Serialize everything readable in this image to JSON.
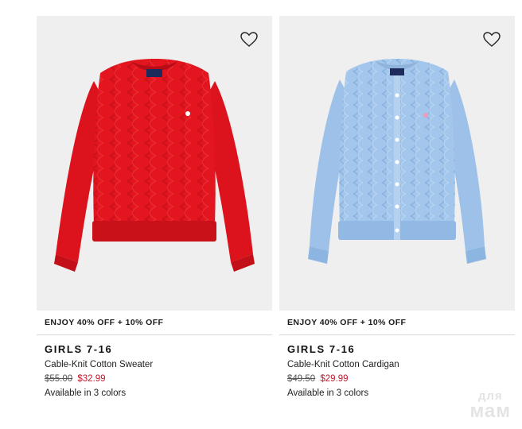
{
  "products": [
    {
      "promo": "ENJOY 40% OFF + 10% OFF",
      "category": "GIRLS 7-16",
      "name": "Cable-Knit Cotton Sweater",
      "original_price": "$55.00",
      "sale_price": "$32.99",
      "availability": "Available in 3 colors",
      "color": "#e3151f",
      "favorite_icon": "heart-outline-icon"
    },
    {
      "promo": "ENJOY 40% OFF + 10% OFF",
      "category": "GIRLS 7-16",
      "name": "Cable-Knit Cotton Cardigan",
      "original_price": "$49.50",
      "sale_price": "$29.99",
      "availability": "Available in 3 colors",
      "color": "#a3c6ec",
      "favorite_icon": "heart-outline-icon"
    }
  ],
  "watermark": {
    "line1": "для",
    "line2": "мам"
  }
}
